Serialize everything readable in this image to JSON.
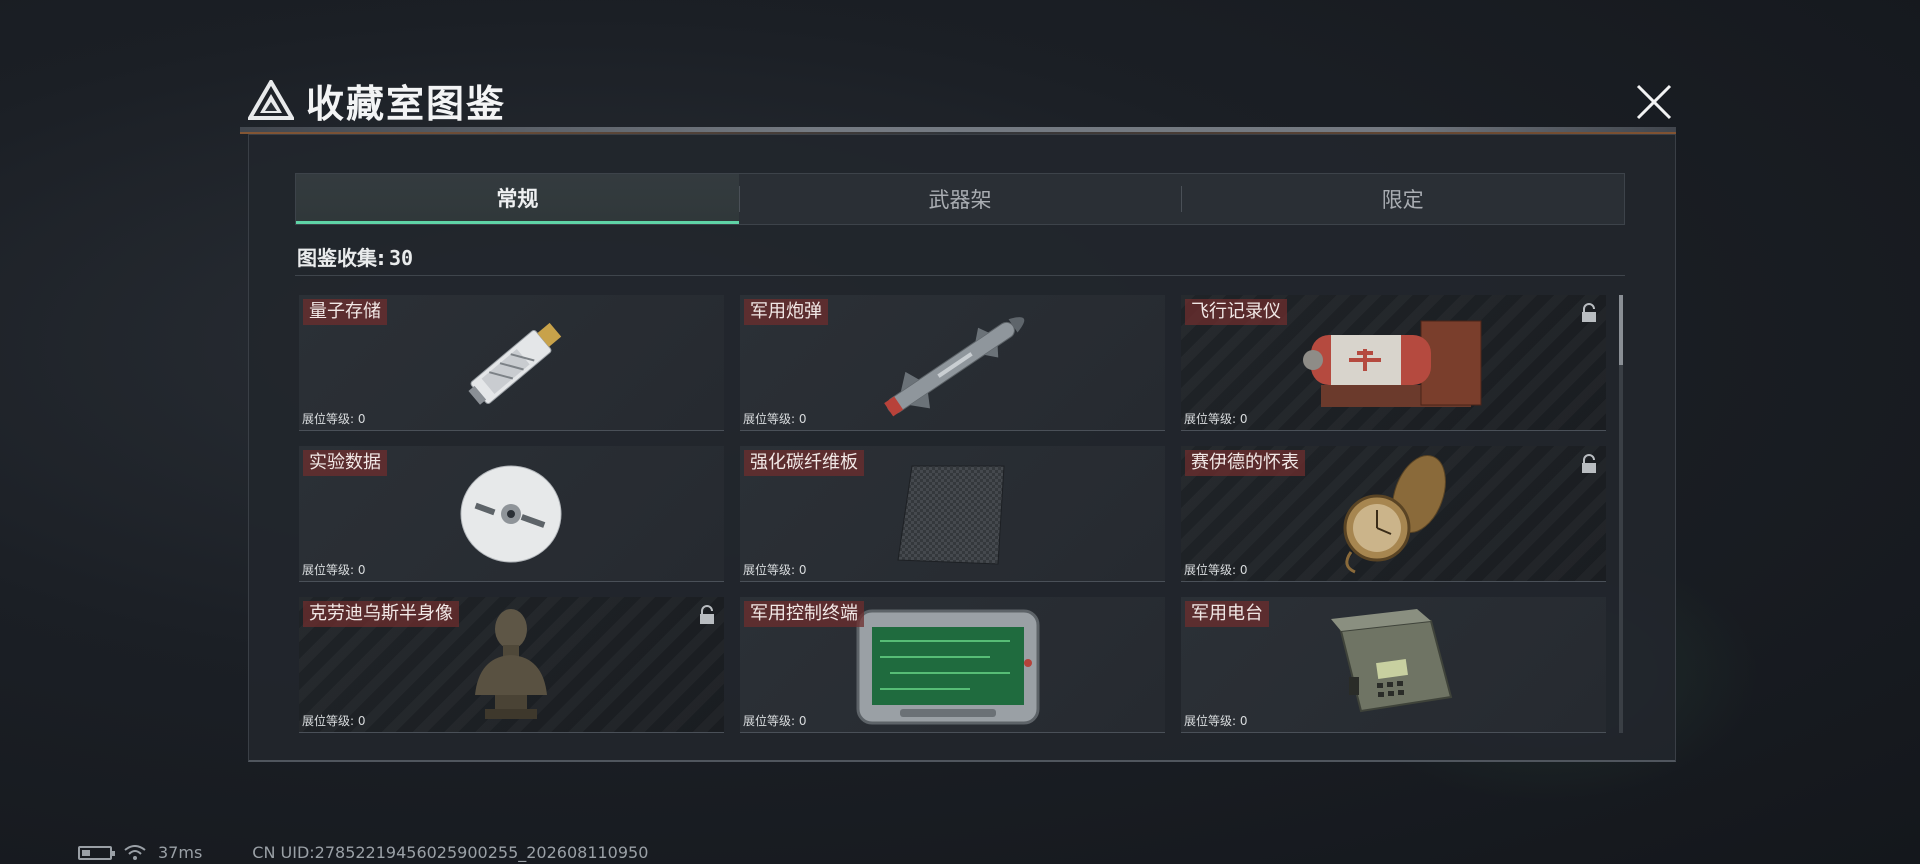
{
  "title": "收藏室图鉴",
  "tabs": [
    {
      "label": "常规",
      "active": true
    },
    {
      "label": "武器架",
      "active": false
    },
    {
      "label": "限定",
      "active": false
    }
  ],
  "collection": {
    "label": "图鉴收集:",
    "count": "30"
  },
  "items": [
    {
      "name": "量子存储",
      "level": "展位等级: 0",
      "locked": false,
      "icon": "usb-drive-icon"
    },
    {
      "name": "军用炮弹",
      "level": "展位等级: 0",
      "locked": false,
      "icon": "missile-icon"
    },
    {
      "name": "飞行记录仪",
      "level": "展位等级: 0",
      "locked": true,
      "icon": "flight-recorder-icon"
    },
    {
      "name": "实验数据",
      "level": "展位等级: 0",
      "locked": false,
      "icon": "disc-icon"
    },
    {
      "name": "强化碳纤维板",
      "level": "展位等级: 0",
      "locked": false,
      "icon": "carbon-plate-icon"
    },
    {
      "name": "赛伊德的怀表",
      "level": "展位等级: 0",
      "locked": true,
      "icon": "pocket-watch-icon"
    },
    {
      "name": "克劳迪乌斯半身像",
      "level": "展位等级: 0",
      "locked": true,
      "icon": "bust-icon"
    },
    {
      "name": "军用控制终端",
      "level": "展位等级: 0",
      "locked": false,
      "icon": "terminal-icon"
    },
    {
      "name": "军用电台",
      "level": "展位等级: 0",
      "locked": false,
      "icon": "radio-icon"
    }
  ],
  "status": {
    "ping": "37ms",
    "uid": "CN UID:27852219456025900255_202608110950"
  },
  "colors": {
    "accent": "#5fd3a6",
    "label_bg": "#6e2d2d"
  }
}
